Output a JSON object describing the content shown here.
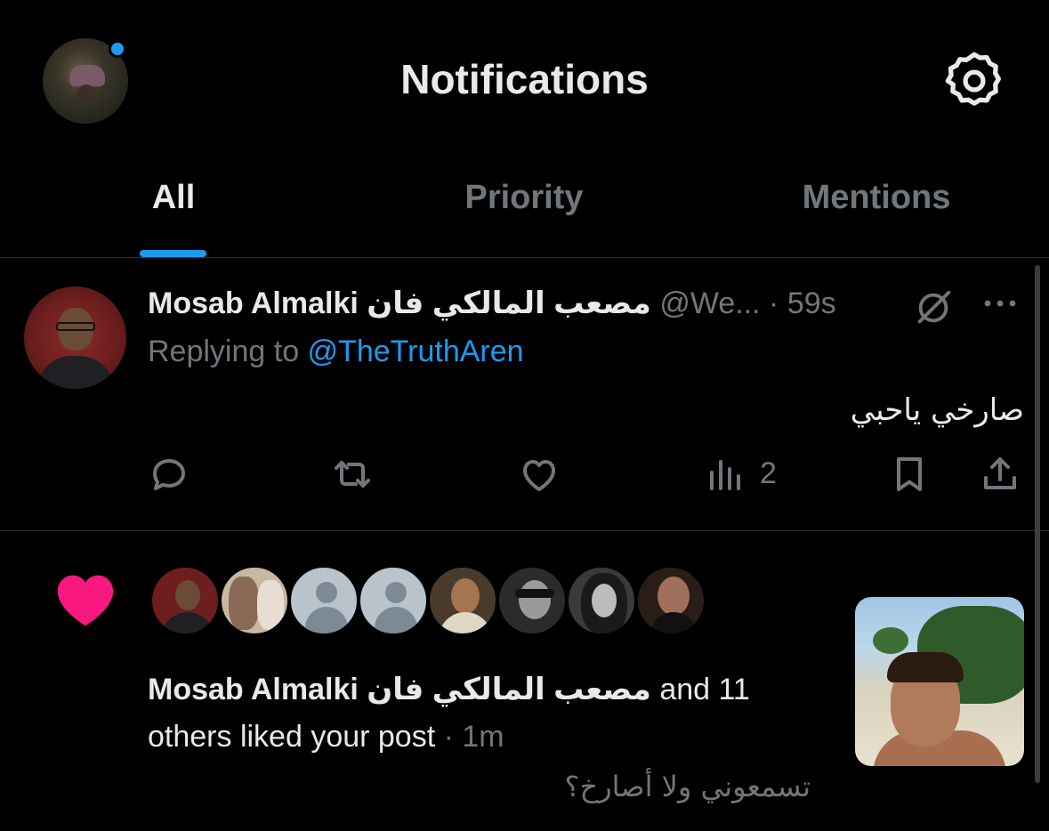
{
  "header": {
    "title": "Notifications",
    "has_unread_dot": true
  },
  "tabs": [
    {
      "label": "All",
      "active": true
    },
    {
      "label": "Priority",
      "active": false
    },
    {
      "label": "Mentions",
      "active": false
    }
  ],
  "tweet": {
    "author_name": "Mosab Almalki مصعب المالكي فان",
    "handle": "@We...",
    "separator": "·",
    "time": "59s",
    "replying_prefix": "Replying to ",
    "replying_to": "@TheTruthAren",
    "text": "صارخي ياحبي",
    "views_count": "2",
    "icons": [
      "reply-icon",
      "retweet-icon",
      "like-icon",
      "views-icon",
      "bookmark-icon",
      "share-icon",
      "grok-icon",
      "more-icon"
    ]
  },
  "like_notification": {
    "author_name": "Mosab Almalki مصعب المالكي فان",
    "and_others": " and 11",
    "rest": "others liked your post",
    "separator": " · ",
    "time": "1m",
    "post_preview": "تسمعوني ولا أصارخ؟",
    "liker_count_shown": 8,
    "heart_color": "#f91880"
  },
  "colors": {
    "accent": "#1d9bf0",
    "muted": "#71767b",
    "text": "#e7e9ea",
    "background": "#000000"
  }
}
